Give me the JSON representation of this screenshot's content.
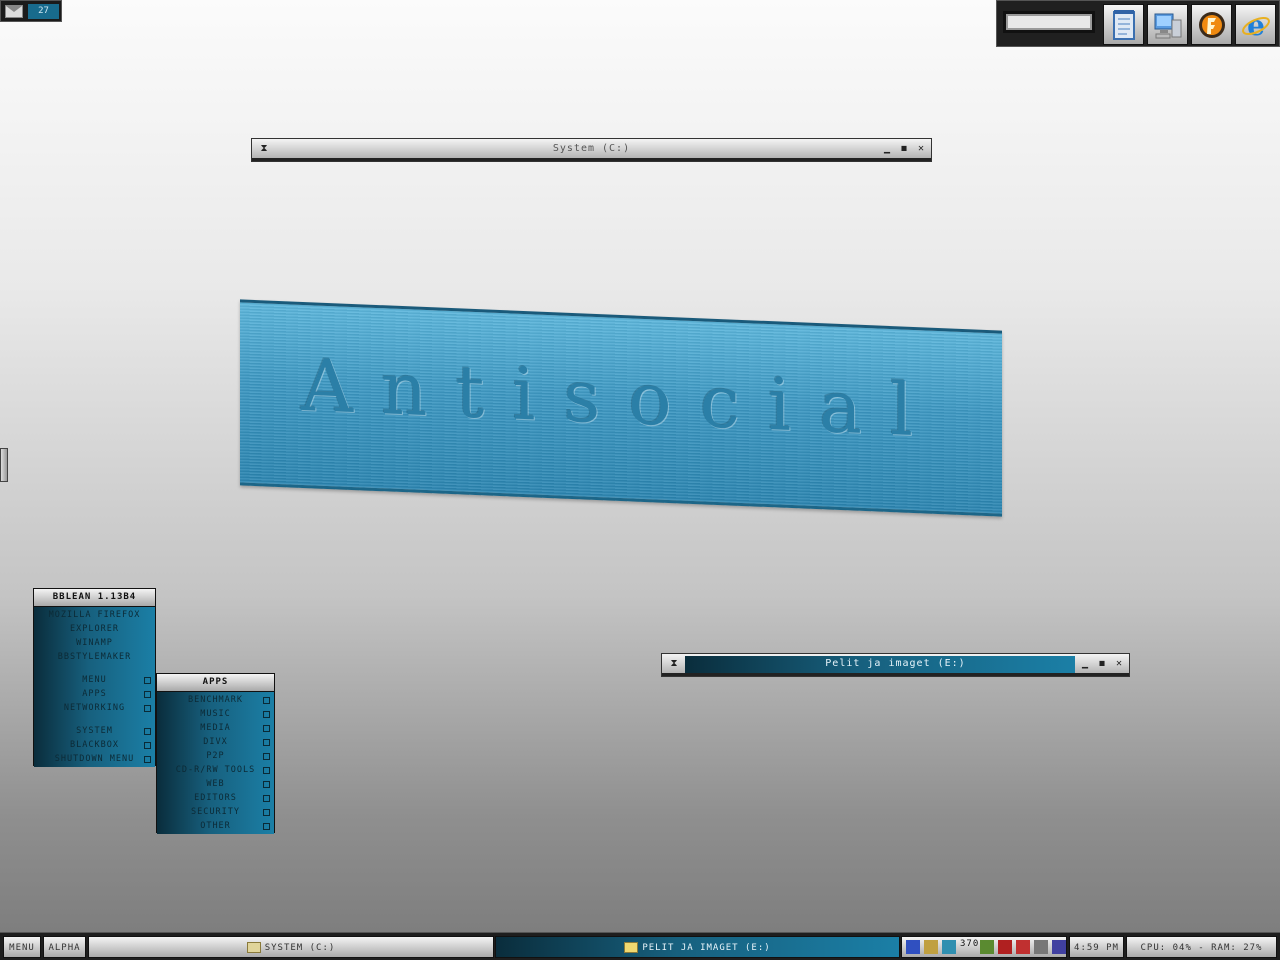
{
  "mail": {
    "count": "27"
  },
  "top_toolbar": {
    "buttons": [
      {
        "name": "notepad-icon"
      },
      {
        "name": "my-computer-icon"
      },
      {
        "name": "fl-studio-icon"
      },
      {
        "name": "internet-explorer-icon"
      }
    ]
  },
  "window_system": {
    "title": "System (C:)"
  },
  "window_pelit": {
    "title": "Pelit ja imaget (E:)"
  },
  "banner": {
    "text": "Antisocial"
  },
  "main_menu": {
    "title": "BBLEAN 1.13B4",
    "launch_items": [
      "MOZILLA FIREFOX",
      "EXPLORER",
      "WINAMP",
      "BBSTYLEMAKER"
    ],
    "folder_items": [
      "MENU",
      "APPS",
      "NETWORKING"
    ],
    "system_items": [
      "SYSTEM",
      "BLACKBOX",
      "SHUTDOWN MENU"
    ]
  },
  "apps_menu": {
    "title": "APPS",
    "items": [
      "BENCHMARK",
      "MUSIC",
      "MEDIA",
      "DIVX",
      "P2P",
      "CD-R/RW TOOLS",
      "WEB",
      "EDITORS",
      "SECURITY",
      "OTHER"
    ]
  },
  "taskbar": {
    "menu_label": "MENU",
    "alpha_label": "ALPHA",
    "task1": "SYSTEM (C:)",
    "task2": "PELIT JA IMAGET (E:)",
    "tray_badge": "370",
    "clock": "4:59 PM",
    "stats": "CPU: 04% - RAM: 27%"
  },
  "colors": {
    "accent_blue": "#1b7fa6",
    "banner_blue": "#3c98c3",
    "dark": "#1e1e1e"
  }
}
